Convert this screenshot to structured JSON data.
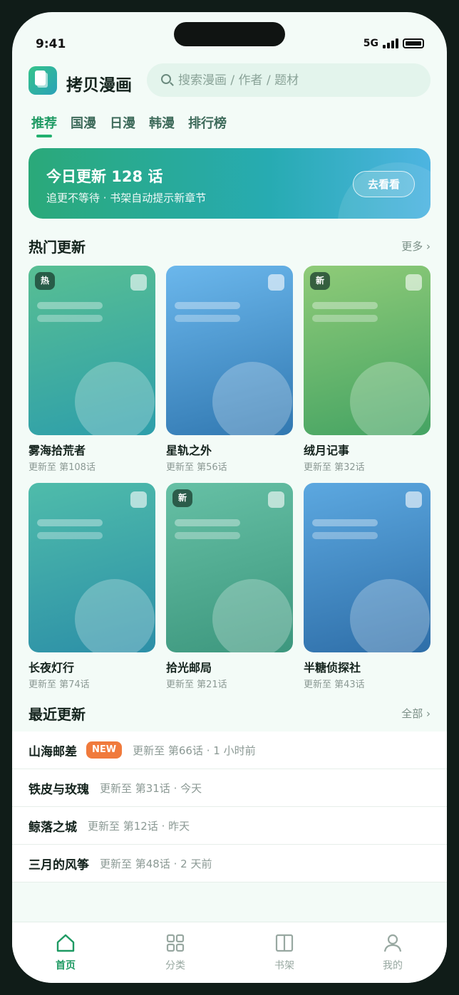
{
  "status": {
    "time": "9:41",
    "network": "5G"
  },
  "app": {
    "name": "拷贝漫画"
  },
  "search": {
    "placeholder": "搜索漫画 / 作者 / 题材"
  },
  "tabs": [
    "推荐",
    "国漫",
    "日漫",
    "韩漫",
    "排行榜"
  ],
  "banner": {
    "title": "今日更新 128 话",
    "subtitle": "追更不等待 · 书架自动提示新章节",
    "button": "去看看"
  },
  "hot": {
    "title": "热门更新",
    "more": "更多 ›",
    "cards": [
      {
        "title": "雾海拾荒者",
        "sub": "更新至 第108话",
        "badge": "热"
      },
      {
        "title": "星轨之外",
        "sub": "更新至 第56话",
        "badge": ""
      },
      {
        "title": "绒月记事",
        "sub": "更新至 第32话",
        "badge": "新"
      },
      {
        "title": "长夜灯行",
        "sub": "更新至 第74话",
        "badge": ""
      },
      {
        "title": "拾光邮局",
        "sub": "更新至 第21话",
        "badge": "新"
      },
      {
        "title": "半糖侦探社",
        "sub": "更新至 第43话",
        "badge": ""
      }
    ]
  },
  "recent": {
    "title": "最近更新",
    "more": "全部 ›",
    "rows": [
      {
        "title": "山海邮差",
        "badge": "NEW",
        "meta": "更新至 第66话 · 1 小时前"
      },
      {
        "title": "铁皮与玫瑰",
        "meta": "更新至 第31话 · 今天"
      },
      {
        "title": "鲸落之城",
        "meta": "更新至 第12话 · 昨天"
      },
      {
        "title": "三月的风筝",
        "meta": "更新至 第48话 · 2 天前"
      }
    ]
  },
  "tabbar": {
    "home": "首页",
    "category": "分类",
    "shelf": "书架",
    "mine": "我的"
  },
  "colors": {
    "accent": "#1e9a63",
    "badge_new": "#f07a3c"
  }
}
